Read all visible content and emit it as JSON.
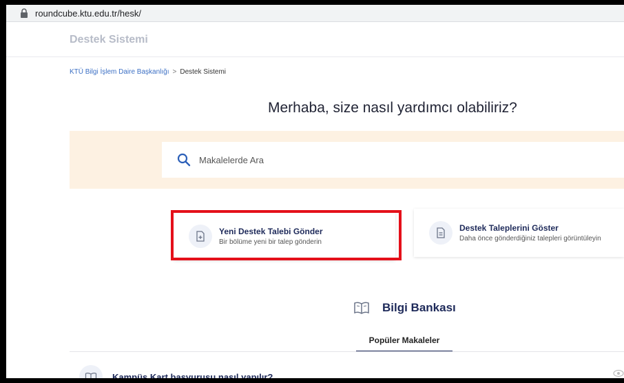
{
  "browser": {
    "url": "roundcube.ktu.edu.tr/hesk/"
  },
  "header": {
    "brand": "Destek Sistemi"
  },
  "breadcrumb": {
    "parent": "KTÜ Bilgi İşlem Daire Başkanlığı",
    "separator": ">",
    "current": "Destek Sistemi"
  },
  "hero": {
    "title": "Merhaba, size nasıl yardımcı olabiliriz?"
  },
  "search": {
    "placeholder": "Makalelerde Ara"
  },
  "actions": [
    {
      "title": "Yeni Destek Talebi Gönder",
      "subtitle": "Bir bölüme yeni bir talep gönderin",
      "icon": "document-plus-icon"
    },
    {
      "title": "Destek Taleplerini Göster",
      "subtitle": "Daha önce gönderdiğiniz talepleri görüntüleyin",
      "icon": "document-lines-icon"
    }
  ],
  "knowledge_base": {
    "title": "Bilgi Bankası",
    "icon": "open-book-icon",
    "tab": "Popüler Makaleler",
    "articles": [
      {
        "title": "Kampüs Kart başvurusu nasıl yapılır?"
      }
    ]
  },
  "colors": {
    "accent": "#1e2a5a",
    "link": "#3b6fc4",
    "search_band": "#fdf1e2",
    "highlight": "#e4101a"
  }
}
